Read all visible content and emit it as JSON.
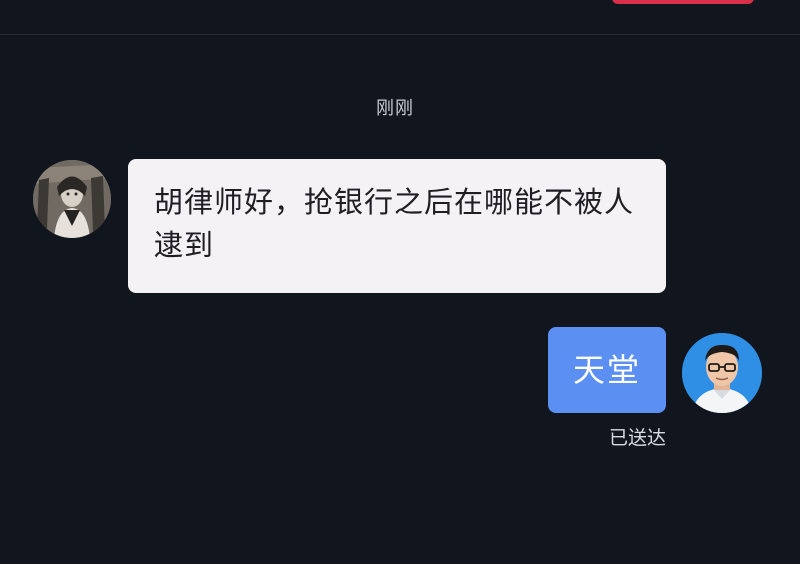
{
  "header": {
    "accent_color": "#d9304a"
  },
  "chat": {
    "timestamp": "刚刚",
    "incoming": {
      "text": "胡律师好，抢银行之后在哪能不被人逮到",
      "avatar_icon": "user-avatar-illustration-icon"
    },
    "outgoing": {
      "text": "天堂",
      "status": "已送达",
      "bubble_color": "#5b8ff1",
      "avatar_icon": "lawyer-avatar-icon"
    }
  }
}
